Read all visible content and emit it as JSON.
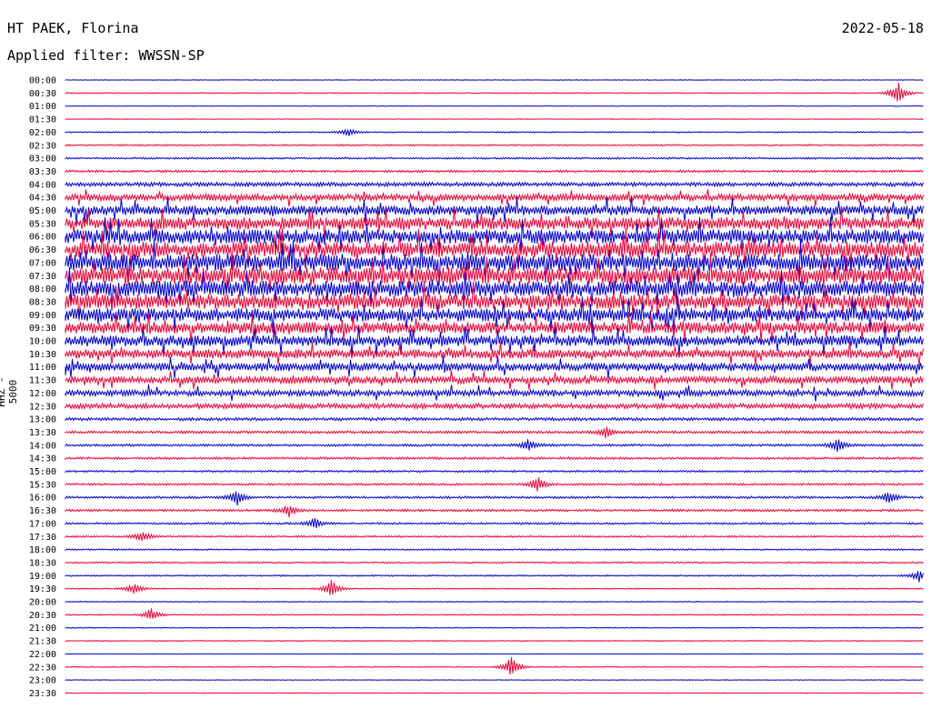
{
  "header": {
    "station": "HT PAEK, Florina",
    "date": "2022-05-18",
    "filter_text": "Applied filter: WWSSN-SP"
  },
  "colors": {
    "even_row": "#0000cc",
    "odd_row": "#ee0033"
  },
  "chart_data": {
    "type": "line",
    "title": "HT PAEK, Florina",
    "ylabel": "HHZ - 5000",
    "x_span": "30 minutes per trace line",
    "rows": [
      "00:00",
      "00:30",
      "01:00",
      "01:30",
      "02:00",
      "02:30",
      "03:00",
      "03:30",
      "04:00",
      "04:30",
      "05:00",
      "05:30",
      "06:00",
      "06:30",
      "07:00",
      "07:30",
      "08:00",
      "08:30",
      "09:00",
      "09:30",
      "10:00",
      "10:30",
      "11:00",
      "11:30",
      "12:00",
      "12:30",
      "13:00",
      "13:30",
      "14:00",
      "14:30",
      "15:00",
      "15:30",
      "16:00",
      "16:30",
      "17:00",
      "17:30",
      "18:00",
      "18:30",
      "19:00",
      "19:30",
      "20:00",
      "20:30",
      "21:00",
      "21:30",
      "22:00",
      "22:30",
      "23:00",
      "23:30"
    ],
    "noise_level": [
      0.3,
      0.4,
      0.3,
      0.3,
      0.5,
      0.6,
      0.7,
      0.9,
      1.6,
      2.6,
      3.8,
      4.8,
      5.6,
      6.2,
      6.8,
      6.6,
      6.4,
      5.8,
      5.2,
      4.6,
      4.2,
      3.6,
      3.2,
      2.8,
      2.4,
      2.0,
      1.2,
      1.0,
      0.9,
      0.9,
      0.8,
      0.8,
      0.9,
      0.9,
      0.8,
      0.7,
      0.6,
      0.6,
      0.6,
      0.5,
      0.4,
      0.5,
      0.4,
      0.4,
      0.3,
      0.4,
      0.3,
      0.3
    ],
    "events": [
      {
        "row": "00:30",
        "x_frac": 0.97,
        "amp": 14
      },
      {
        "row": "19:00",
        "x_frac": 0.995,
        "amp": 8
      },
      {
        "row": "19:30",
        "x_frac": 0.31,
        "amp": 10
      },
      {
        "row": "19:30",
        "x_frac": 0.08,
        "amp": 7
      },
      {
        "row": "20:30",
        "x_frac": 0.1,
        "amp": 8
      },
      {
        "row": "22:30",
        "x_frac": 0.52,
        "amp": 14
      },
      {
        "row": "16:30",
        "x_frac": 0.26,
        "amp": 8
      },
      {
        "row": "16:00",
        "x_frac": 0.2,
        "amp": 9
      },
      {
        "row": "16:00",
        "x_frac": 0.96,
        "amp": 8
      },
      {
        "row": "14:00",
        "x_frac": 0.54,
        "amp": 8
      },
      {
        "row": "14:00",
        "x_frac": 0.9,
        "amp": 8
      },
      {
        "row": "15:30",
        "x_frac": 0.55,
        "amp": 9
      },
      {
        "row": "17:00",
        "x_frac": 0.29,
        "amp": 7
      },
      {
        "row": "17:30",
        "x_frac": 0.09,
        "amp": 7
      },
      {
        "row": "02:00",
        "x_frac": 0.33,
        "amp": 5
      },
      {
        "row": "13:30",
        "x_frac": 0.63,
        "amp": 7
      }
    ]
  }
}
